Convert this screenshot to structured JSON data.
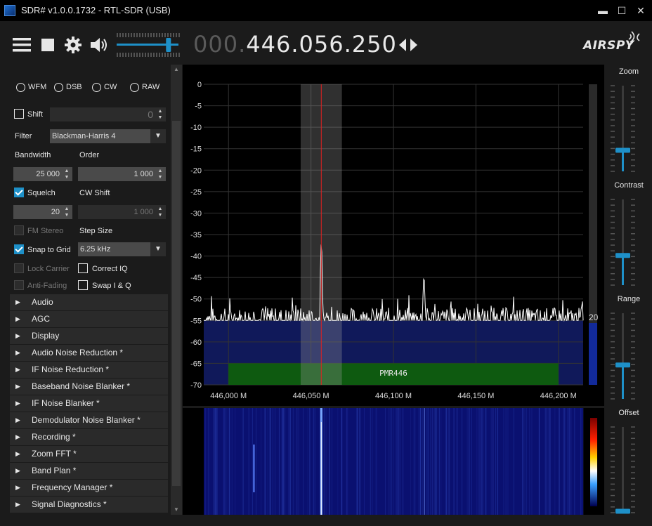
{
  "window": {
    "title": "SDR# v1.0.0.1732 - RTL-SDR (USB)",
    "minimize": "▬",
    "maximize": "☐",
    "close": "✕"
  },
  "toolbar": {
    "freq_dim": "000.",
    "freq_main": "446.056.250",
    "logo": "AIRSPY",
    "icons": [
      "menu-icon",
      "stop-icon",
      "gear-icon",
      "speaker-icon",
      "arrows-icon"
    ],
    "volume": 0.95
  },
  "radio": {
    "modes": [
      "WFM",
      "DSB",
      "CW",
      "RAW"
    ],
    "shift_label": "Shift",
    "shift_value": "0",
    "filter_label": "Filter",
    "filter_value": "Blackman-Harris 4",
    "bandwidth_label": "Bandwidth",
    "bandwidth_value": "25 000",
    "order_label": "Order",
    "order_value": "1 000",
    "squelch_label": "Squelch",
    "squelch_value": "20",
    "cwshift_label": "CW Shift",
    "cwshift_value": "1 000",
    "fmstereo_label": "FM Stereo",
    "stepsize_label": "Step Size",
    "snap_label": "Snap to Grid",
    "step_value": "6.25 kHz",
    "lockcarrier_label": "Lock Carrier",
    "correctiq_label": "Correct IQ",
    "antifading_label": "Anti-Fading",
    "swapiq_label": "Swap I & Q"
  },
  "sections": [
    "Audio",
    "AGC",
    "Display",
    "Audio Noise Reduction *",
    "IF Noise Reduction *",
    "Baseband Noise Blanker *",
    "IF Noise Blanker *",
    "Demodulator Noise Blanker *",
    "Recording *",
    "Zoom FFT *",
    "Band Plan *",
    "Frequency Manager *",
    "Signal Diagnostics *"
  ],
  "spectrum": {
    "y_ticks": [
      "0",
      "-5",
      "-10",
      "-15",
      "-20",
      "-25",
      "-30",
      "-35",
      "-40",
      "-45",
      "-50",
      "-55",
      "-60",
      "-65",
      "-70"
    ],
    "x_ticks": [
      "446,000 M",
      "446,050 M",
      "446,100 M",
      "446,150 M",
      "446,200 M"
    ],
    "band_label": "PMR446",
    "level_label": "20"
  },
  "chart_data": {
    "type": "line",
    "ylim": [
      -70,
      0
    ],
    "xlim": [
      445.985,
      446.215
    ],
    "x_ticks": [
      446.0,
      446.05,
      446.1,
      446.15,
      446.2
    ],
    "noise_floor": -55,
    "peaks": [
      {
        "x": 446.05625,
        "y": -37
      },
      {
        "x": 446.1185,
        "y": -45
      }
    ],
    "band_plan": {
      "name": "PMR446",
      "start": 446.0,
      "end": 446.2
    },
    "filter": {
      "center": 446.05625,
      "bandwidth_khz": 25
    }
  },
  "right": {
    "zoom": "Zoom",
    "contrast": "Contrast",
    "range": "Range",
    "offset": "Offset",
    "zoom_level": 0.25,
    "contrast_level": 0.35,
    "range_level": 0.4,
    "offset_level": 0.02
  }
}
